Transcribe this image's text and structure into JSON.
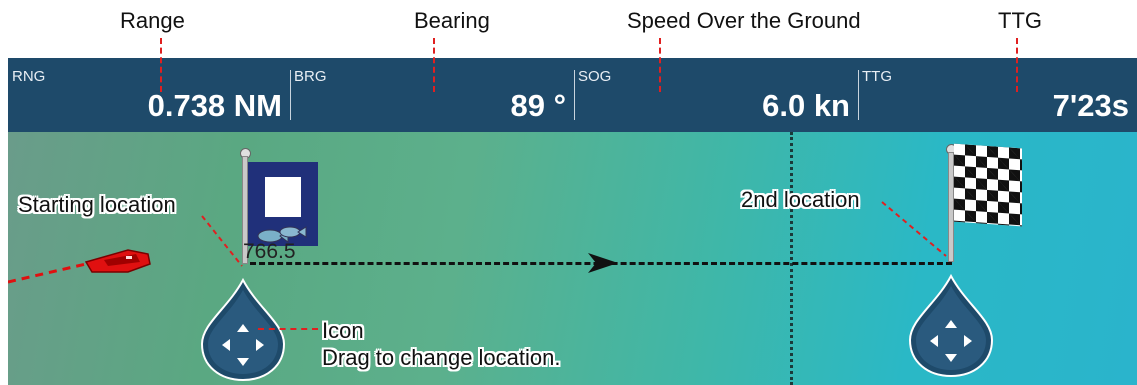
{
  "callouts": {
    "range": "Range",
    "bearing": "Bearing",
    "sog": "Speed Over the Ground",
    "ttg": "TTG"
  },
  "databar": {
    "rng": {
      "label": "RNG",
      "value": "0.738 NM"
    },
    "brg": {
      "label": "BRG",
      "value": "89 °"
    },
    "sog": {
      "label": "SOG",
      "value": "6.0 kn"
    },
    "ttg": {
      "label": "TTG",
      "value": "7'23s"
    }
  },
  "chart": {
    "depth_label": "766.5",
    "annotations": {
      "start": "Starting location",
      "second": "2nd location",
      "icon_title": "Icon",
      "icon_desc": "Drag to change location."
    }
  },
  "colors": {
    "databar_bg": "#1e4a6a",
    "leader": "#e02020",
    "boat": "#e01010",
    "flag_blue": "#20307a"
  },
  "icons": [
    "boat-icon",
    "start-flag-icon",
    "checkered-flag-icon",
    "fish-icon",
    "drag-handle-icon"
  ]
}
